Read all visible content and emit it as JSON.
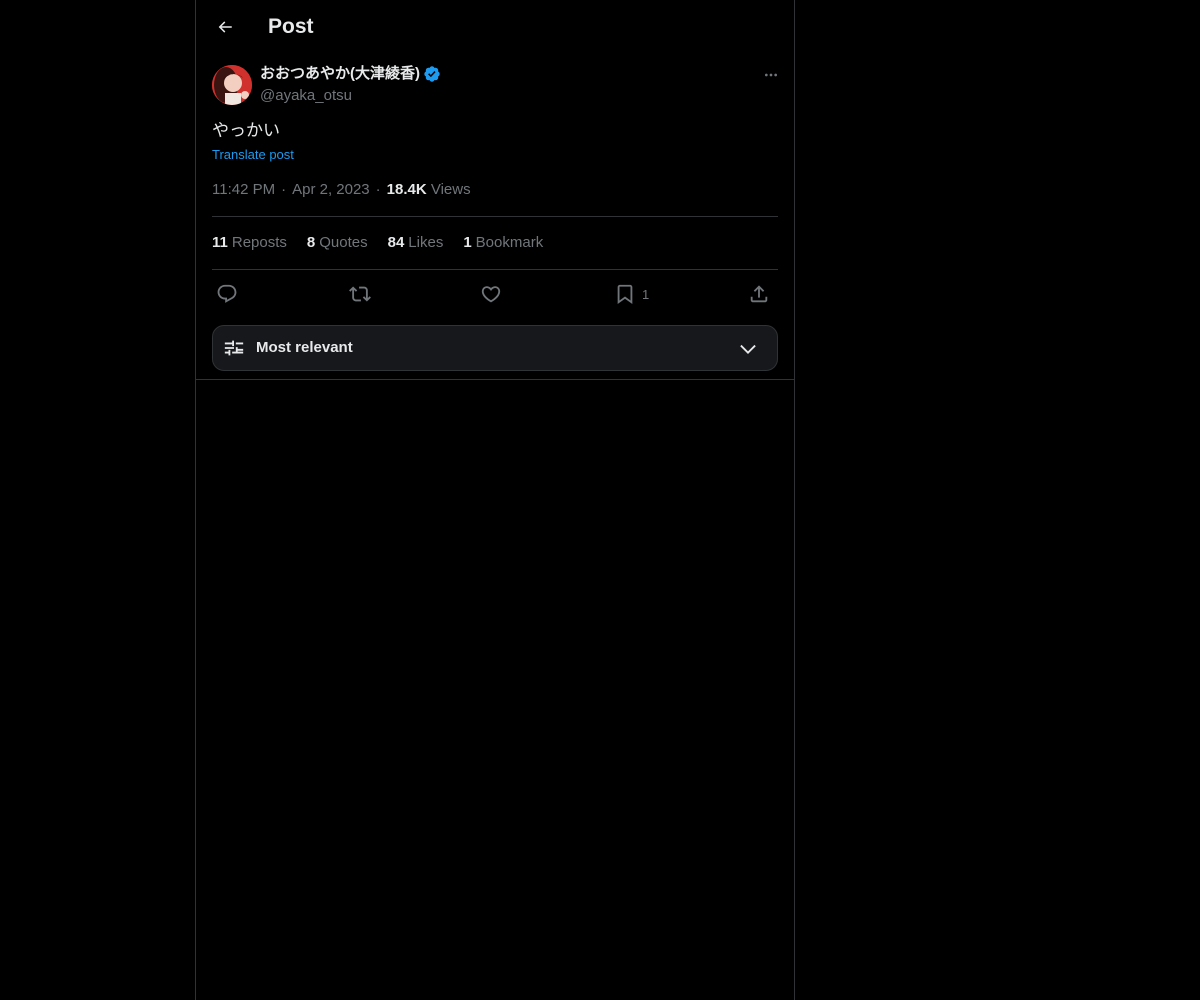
{
  "header": {
    "title": "Post",
    "back_icon": "arrow-left-icon"
  },
  "post": {
    "author": {
      "display_name": "おおつあやか(大津綾香)",
      "handle": "@ayaka_otsu",
      "verified": true,
      "verified_color": "#1d9bf0"
    },
    "text": "やっかい",
    "translate_label": "Translate post",
    "time": "11:42 PM",
    "date": "Apr 2, 2023",
    "views_count": "18.4K",
    "views_label": "Views"
  },
  "stats": {
    "reposts": {
      "count": "11",
      "label": "Reposts"
    },
    "quotes": {
      "count": "8",
      "label": "Quotes"
    },
    "likes": {
      "count": "84",
      "label": "Likes"
    },
    "bookmarks": {
      "count": "1",
      "label": "Bookmark"
    }
  },
  "actions": {
    "reply_icon": "reply-icon",
    "repost_icon": "repost-icon",
    "like_icon": "heart-icon",
    "bookmark_icon": "bookmark-icon",
    "bookmark_count": "1",
    "share_icon": "share-icon"
  },
  "sort": {
    "label": "Most relevant",
    "icon": "filter-sliders-icon",
    "chevron": "chevron-down-icon"
  },
  "colors": {
    "background": "#000000",
    "text": "#e7e9ea",
    "muted": "#71767b",
    "accent": "#1d9bf0",
    "border": "#2f3336"
  }
}
